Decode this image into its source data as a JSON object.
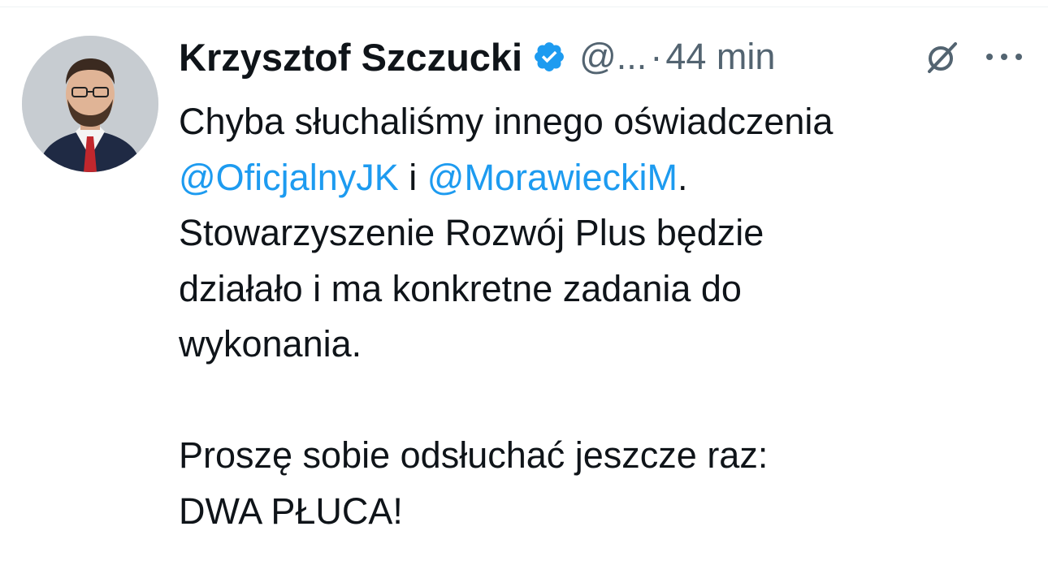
{
  "author": {
    "display_name": "Krzysztof Szczucki",
    "handle": "@...",
    "verified_icon": "verified-badge-icon",
    "avatar": "profile-photo"
  },
  "meta": {
    "separator": "·",
    "time": "44 min"
  },
  "actions": {
    "grok_icon": "grok-icon",
    "more_icon": "more-options-icon"
  },
  "tweet": {
    "line1": "Chyba słuchaliśmy innego oświadczenia",
    "mention1": "@OficjalnyJK",
    "connector": " i ",
    "mention2": "@MorawieckiM",
    "line2_end": ".",
    "line3": "Stowarzyszenie Rozwój Plus będzie",
    "line4": "działało i ma konkretne zadania do",
    "line5": "wykonania.",
    "line6": "Proszę sobie odsłuchać jeszcze raz:",
    "line7": "DWA PŁUCA!"
  },
  "colors": {
    "link": "#1d9bf0",
    "secondary_text": "#536471",
    "primary_text": "#0f1419"
  }
}
